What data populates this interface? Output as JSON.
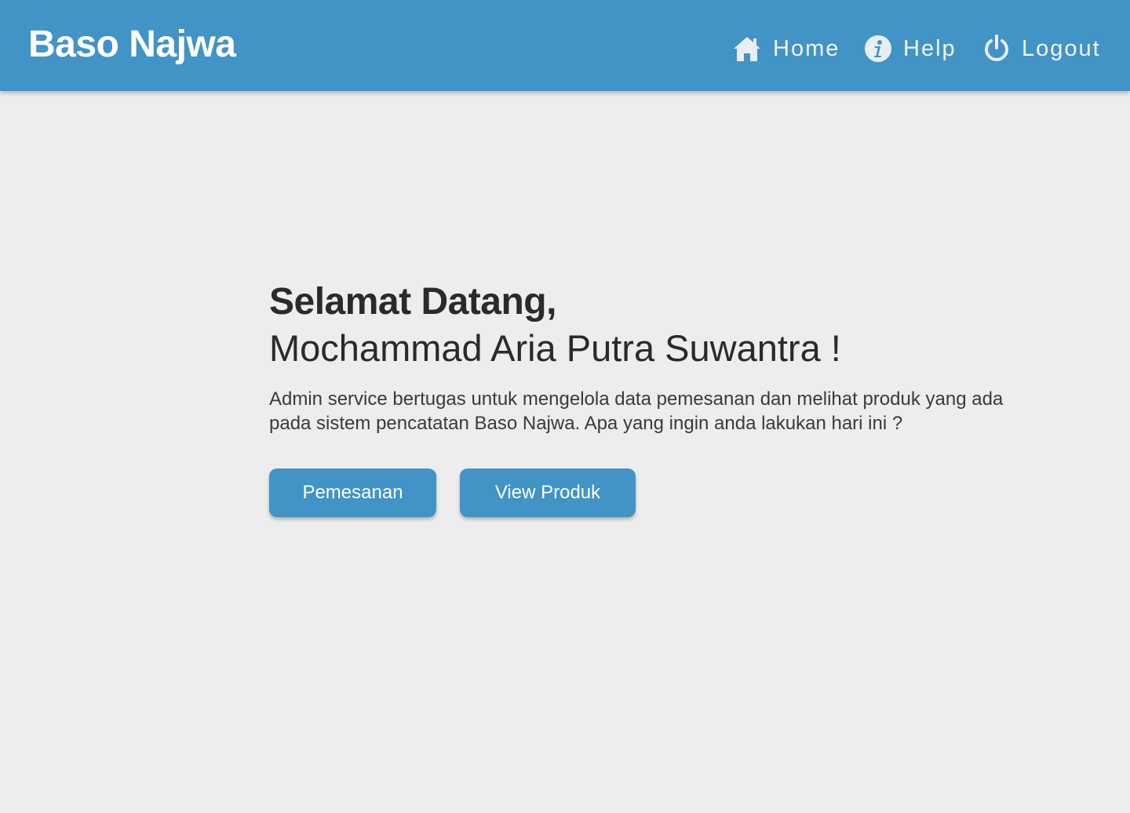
{
  "header": {
    "brand": "Baso Najwa",
    "nav": {
      "home": {
        "label": "Home",
        "icon": "home-icon"
      },
      "help": {
        "label": "Help",
        "icon": "info-icon"
      },
      "logout": {
        "label": "Logout",
        "icon": "power-icon"
      }
    }
  },
  "main": {
    "greeting": "Selamat Datang,",
    "user_name": "Mochammad Aria Putra Suwantra !",
    "description": "Admin service bertugas untuk mengelola data pemesanan dan melihat produk yang ada pada sistem pencatatan Baso Najwa. Apa yang ingin anda lakukan hari ini ?",
    "buttons": {
      "order": "Pemesanan",
      "product": "View Produk"
    }
  },
  "colors": {
    "header_bg": "#4293c6",
    "page_bg": "#ededed",
    "button_bg": "#4293c6",
    "text_dark": "#2a2a2a"
  }
}
